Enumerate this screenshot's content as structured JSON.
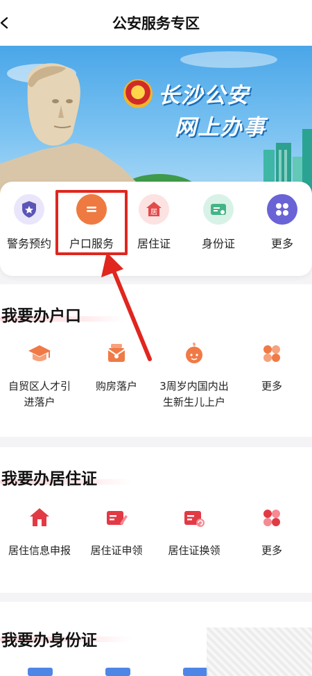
{
  "header": {
    "title": "公安服务专区"
  },
  "banner": {
    "title": "长沙公安",
    "subtitle": "网上办事"
  },
  "quick_services": [
    {
      "label": "警务预约",
      "icon": "shield-star-icon",
      "color": "#5b55b8"
    },
    {
      "label": "户口服务",
      "icon": "household-icon",
      "color": "#ee7a42"
    },
    {
      "label": "居住证",
      "icon": "residence-permit-icon",
      "color": "#e24a4a"
    },
    {
      "label": "身份证",
      "icon": "id-card-icon",
      "color": "#45b487"
    },
    {
      "label": "更多",
      "icon": "more-grid-icon",
      "color": "#6a63d6"
    }
  ],
  "sections": [
    {
      "title": "我要办户口",
      "items": [
        {
          "label": "自贸区人才引进落户",
          "line1": "自贸区人才引",
          "line2": "进落户",
          "icon": "graduation-cap-icon"
        },
        {
          "label": "购房落户",
          "line1": "购房落户",
          "line2": "",
          "icon": "house-purchase-icon"
        },
        {
          "label": "3周岁内国内出生新生儿上户",
          "line1": "3周岁内国内出",
          "line2": "生新生儿上户",
          "icon": "baby-icon"
        },
        {
          "label": "更多",
          "line1": "更多",
          "line2": "",
          "icon": "more-grid-icon"
        }
      ]
    },
    {
      "title": "我要办居住证",
      "items": [
        {
          "label": "居住信息申报",
          "line1": "居住信息申报",
          "line2": "",
          "icon": "home-icon"
        },
        {
          "label": "居住证申领",
          "line1": "居住证申领",
          "line2": "",
          "icon": "card-edit-icon"
        },
        {
          "label": "居住证换领",
          "line1": "居住证换领",
          "line2": "",
          "icon": "card-renew-icon"
        },
        {
          "label": "更多",
          "line1": "更多",
          "line2": "",
          "icon": "more-grid-icon"
        }
      ]
    },
    {
      "title": "我要办身份证",
      "items": []
    }
  ],
  "colors": {
    "accent": "#e24a4a",
    "highlight_box": "#e0261e",
    "banner_sky": "#4aa6e8"
  }
}
